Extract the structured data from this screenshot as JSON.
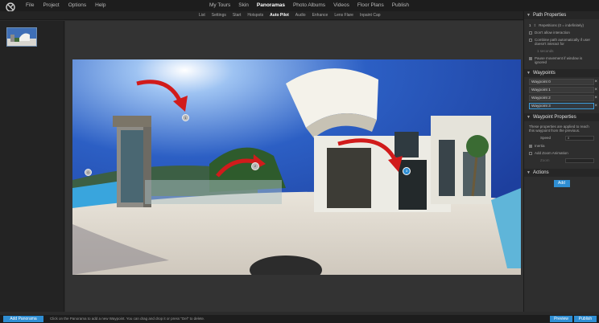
{
  "menu": {
    "left": [
      "File",
      "Project",
      "Options",
      "Help"
    ],
    "main": [
      "My Tours",
      "Skin",
      "Panoramas",
      "Photo Albums",
      "Videos",
      "Floor Plans",
      "Publish"
    ],
    "active_main": "Panoramas"
  },
  "subtoolbar": {
    "items": [
      "List",
      "Settings",
      "Start",
      "Hotspots",
      "Auto Pilot",
      "Audio",
      "Enhance",
      "Lens Flare",
      "Inpaint Cap"
    ],
    "active": "Auto Pilot"
  },
  "right_panel": {
    "path_properties": {
      "title": "Path Properties",
      "repetitions_value": "1",
      "repetitions_label": "Repetitions (0 = indefinitely)",
      "dont_allow": "Don't allow interaction",
      "combine": "Combine path automatically if user doesn't interact for",
      "seconds": "1 seconds",
      "pause": "Pause movement if window is ignored"
    },
    "waypoints": {
      "title": "Waypoints",
      "items": [
        "Waypoint 0",
        "Waypoint 1",
        "Waypoint 2",
        "Waypoint 3"
      ],
      "selected_index": 3
    },
    "waypoint_properties": {
      "title": "Waypoint Properties",
      "desc": "These properties are applied to reach this waypoint from the previous.",
      "speed_label": "Speed",
      "speed_value": "8",
      "inertia": "Inertia",
      "zoom_anim": "Add Zoom Animation",
      "zoom_label": "Zoom"
    },
    "actions": {
      "title": "Actions",
      "add_label": "Add"
    }
  },
  "pano": {
    "waypoint_markers": [
      "0",
      "1",
      "2",
      "3"
    ]
  },
  "status": {
    "add_panorama": "Add Panorama",
    "hint": "Click on the Panorama to add a new Waypoint. You can drag and drop it or press \"Del\" to delete.",
    "preview": "Preview",
    "publish": "Publish"
  },
  "colors": {
    "accent": "#2f8ed3",
    "selected_border": "#3c9bd8"
  }
}
